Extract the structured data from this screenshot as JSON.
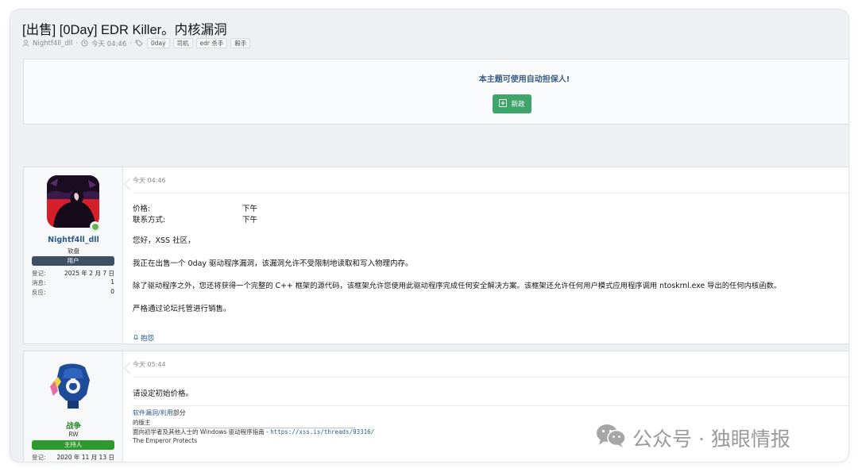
{
  "thread": {
    "title": "[出售] [0Day] EDR Killer。内核漏洞",
    "author": "Nightf4ll_dll",
    "separator": "·",
    "time": "今天 04:46",
    "tags": [
      "0day",
      "司机",
      "edr 杀手",
      "毅手"
    ]
  },
  "escrow": {
    "notice": "本主题可使用自动担保人!",
    "button_label": "新政"
  },
  "posts": [
    {
      "user": {
        "name": "Nightf4ll_dll",
        "title": "软盘",
        "banner": "用户",
        "stats": [
          {
            "label": "登记:",
            "value": "2025 年 2 月 7 日"
          },
          {
            "label": "消息:",
            "value": "1"
          },
          {
            "label": "反应:",
            "value": "0"
          }
        ]
      },
      "time": "今天 04:46",
      "fields": [
        {
          "label": "价格:",
          "value": "下午"
        },
        {
          "label": "联系方式:",
          "value": "下午"
        }
      ],
      "body": [
        "您好，XSS 社区，",
        "我正在出售一个 0day 驱动程序漏洞，该漏洞允许不受限制地读取和写入物理内存。",
        "除了驱动程序之外，您还将获得一个完整的 C++ 框架的源代码，该框架允许您使用此驱动程序完成任何安全解决方案。该框架还允许任何用户模式应用程序调用 ntoskrnl.exe 导出的任何内核函数。",
        "严格通过论坛托管进行销售。"
      ],
      "report_label": "抱怨"
    },
    {
      "user": {
        "name": "战争",
        "title": "RW",
        "banner": "主持人",
        "stats": [
          {
            "label": "登记:",
            "value": "2020 年 11 月 13 日"
          }
        ]
      },
      "time": "今天 05:44",
      "body": [
        "请设定初始价格。"
      ],
      "signature": {
        "line1_link": "软件漏洞/利用",
        "line1_rest": "部分",
        "line2": "的版主",
        "line3_text": "面向初学者及其他人士的 Windows 驱动程序指南 - ",
        "line3_link": "https://xss.is/threads/93316/",
        "line4": "The Emperor Protects"
      }
    }
  ],
  "watermark": {
    "text": "公众号 · 独眼情报"
  },
  "colors": {
    "link": "#2a5a8c",
    "user_banner": "#3e5064",
    "moderator_banner": "#2c9a2c",
    "moderator_name": "#2c8a2c",
    "escrow_button": "#3fa46a"
  }
}
